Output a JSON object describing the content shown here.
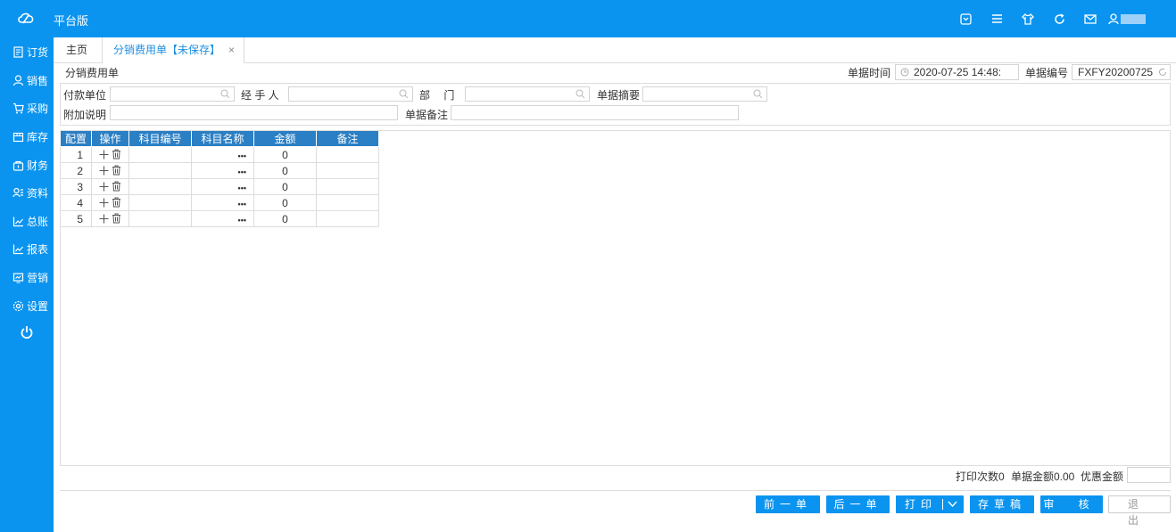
{
  "app": {
    "brand": "平台版"
  },
  "sidebar": {
    "items": [
      {
        "label": "订货",
        "icon": "order-icon"
      },
      {
        "label": "销售",
        "icon": "sales-icon"
      },
      {
        "label": "采购",
        "icon": "cart-icon"
      },
      {
        "label": "库存",
        "icon": "inventory-icon"
      },
      {
        "label": "财务",
        "icon": "finance-icon"
      },
      {
        "label": "资料",
        "icon": "data-icon"
      },
      {
        "label": "总账",
        "icon": "ledger-icon"
      },
      {
        "label": "报表",
        "icon": "report-icon"
      },
      {
        "label": "营销",
        "icon": "marketing-icon"
      },
      {
        "label": "设置",
        "icon": "settings-icon"
      }
    ]
  },
  "tabs": {
    "home": "主页",
    "active": "分销费用单【未保存】",
    "close": "×"
  },
  "form": {
    "title": "分销费用单",
    "date_label": "单据时间",
    "date_value": "2020-07-25 14:48:",
    "number_label": "单据编号",
    "number_value": "FXFY20200725",
    "payer_label": "付款单位",
    "handler_label": "经 手 人",
    "dept_label": "部　 门",
    "summary_label": "单据摘要",
    "extra_label": "附加说明",
    "remark_label": "单据备注"
  },
  "grid": {
    "headers": [
      "配置",
      "操作",
      "科目编号",
      "科目名称",
      "金额",
      "备注"
    ],
    "rows": [
      {
        "no": "1",
        "amount": "0",
        "dots": "•••"
      },
      {
        "no": "2",
        "amount": "0",
        "dots": "•••"
      },
      {
        "no": "3",
        "amount": "0",
        "dots": "•••"
      },
      {
        "no": "4",
        "amount": "0",
        "dots": "•••"
      },
      {
        "no": "5",
        "amount": "0",
        "dots": "•••"
      }
    ]
  },
  "footer": {
    "print_count": "打印次数0",
    "bill_amount": "单据金额0.00",
    "discount_label": "优惠金额"
  },
  "buttons": {
    "prev": "前一单",
    "next": "后一单",
    "print": "打印",
    "draft": "存草稿",
    "audit": "审 核",
    "exit": "退 出"
  }
}
